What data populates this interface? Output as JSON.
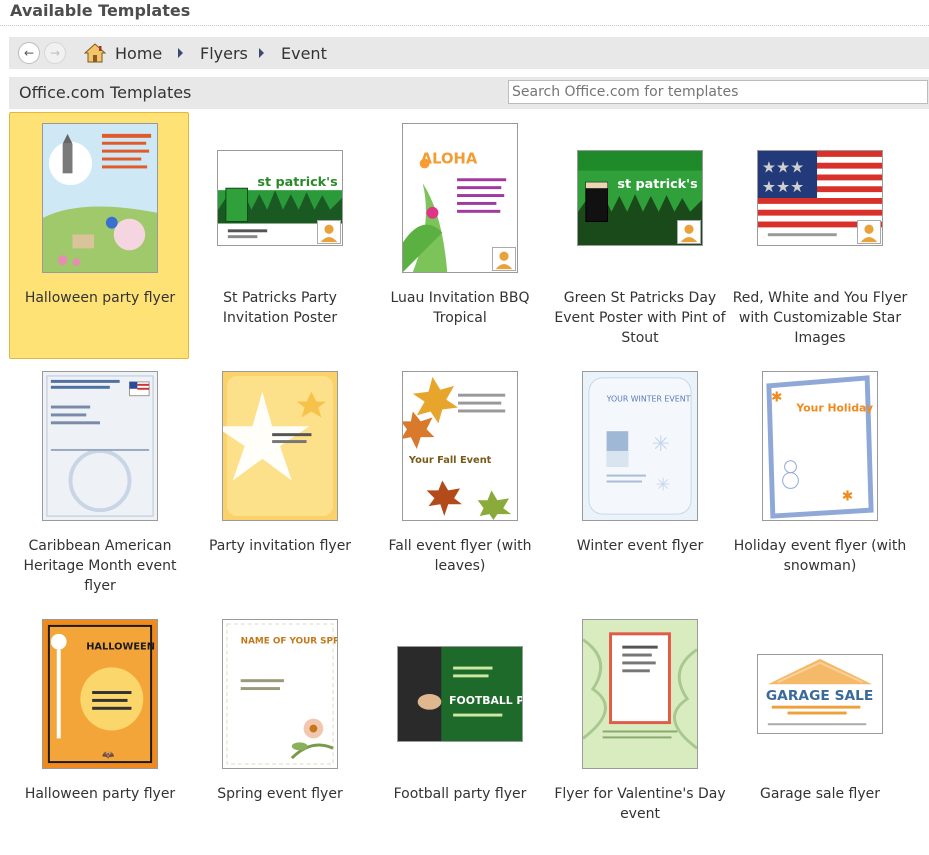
{
  "header": {
    "title": "Available Templates"
  },
  "nav": {
    "crumbs": [
      "Home",
      "Flyers",
      "Event"
    ]
  },
  "office": {
    "title": "Office.com Templates",
    "search_placeholder": "Search Office.com for templates"
  },
  "templates": [
    {
      "label": "Halloween party flyer",
      "selected": true
    },
    {
      "label": "St Patricks Party Invitation Poster"
    },
    {
      "label": "Luau Invitation BBQ Tropical"
    },
    {
      "label": "Green St Patricks Day Event Poster with Pint of Stout"
    },
    {
      "label": "Red, White and You Flyer with Customizable Star Images"
    },
    {
      "label": "Caribbean American Heritage Month event flyer"
    },
    {
      "label": "Party invitation flyer"
    },
    {
      "label": "Fall event flyer (with leaves)"
    },
    {
      "label": "Winter event flyer"
    },
    {
      "label": "Holiday event flyer (with snowman)"
    },
    {
      "label": "Halloween party flyer"
    },
    {
      "label": "Spring event flyer"
    },
    {
      "label": "Football party flyer"
    },
    {
      "label": "Flyer for Valentine's Day event"
    },
    {
      "label": "Garage sale flyer"
    }
  ],
  "thumb_text": {
    "st_patricks": "st patrick's",
    "aloha": "ALOHA",
    "fall": "Your Fall Event",
    "winter": "YOUR WINTER EVENT",
    "holiday": "Your Holiday Event",
    "halloween": "HALLOWEEN PARTY!",
    "spring": "NAME OF YOUR SPRING EVENT",
    "football": "FOOTBALL PARTY!",
    "garage": "GARAGE SALE"
  }
}
